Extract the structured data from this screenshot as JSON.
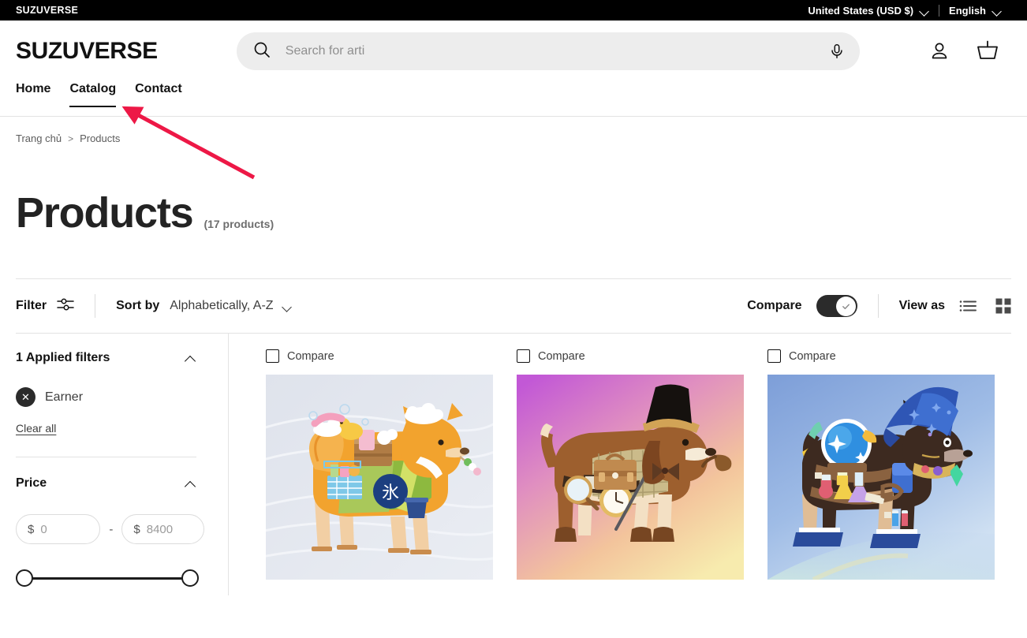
{
  "topbar": {
    "brand": "SUZUVERSE",
    "currency": "United States (USD $)",
    "language": "English"
  },
  "header": {
    "logo": "SUZUVERSE",
    "search_placeholder": "Search for arti",
    "search_value": "",
    "search_icon": "search-icon",
    "mic_icon": "microphone-icon",
    "account_icon": "account-icon",
    "cart_icon": "basket-icon"
  },
  "nav": {
    "items": [
      {
        "label": "Home",
        "active": false
      },
      {
        "label": "Catalog",
        "active": true
      },
      {
        "label": "Contact",
        "active": false
      }
    ]
  },
  "breadcrumb": {
    "home": "Trang chủ",
    "separator": ">",
    "current": "Products"
  },
  "page": {
    "title": "Products",
    "count": "(17 products)"
  },
  "toolbar": {
    "filter_label": "Filter",
    "filter_icon": "sliders-icon",
    "sort_label": "Sort by",
    "sort_value": "Alphabetically, A-Z",
    "compare_label": "Compare",
    "compare_enabled": true,
    "viewas_label": "View as",
    "view_list_icon": "list-view-icon",
    "view_grid_icon": "grid-view-icon"
  },
  "sidebar": {
    "applied": {
      "title": "1 Applied filters",
      "tags": [
        {
          "label": "Earner",
          "remove_icon": "close-circle-icon"
        }
      ],
      "clear_all": "Clear all"
    },
    "price": {
      "title": "Price",
      "currency_symbol": "$",
      "min_value": "0",
      "max_value": "8400",
      "separator": "-"
    }
  },
  "products": [
    {
      "compare_label": "Compare",
      "compare_checked": false,
      "art_name": "onsen-shiba-dog-illustration",
      "bg_from": "#dfe3ec",
      "bg_to": "#e9ecf3"
    },
    {
      "compare_label": "Compare",
      "compare_checked": false,
      "art_name": "detective-beagle-dog-illustration",
      "bg_from": "#c558d8",
      "bg_to": "#f6e9ae"
    },
    {
      "compare_label": "Compare",
      "compare_checked": false,
      "art_name": "wizard-chihuahua-dog-illustration",
      "bg_from": "#7e9fd8",
      "bg_to": "#bcd3ee"
    }
  ],
  "annotation": {
    "arrow_color": "#ed1846",
    "arrow_target": "catalog-nav-item"
  }
}
